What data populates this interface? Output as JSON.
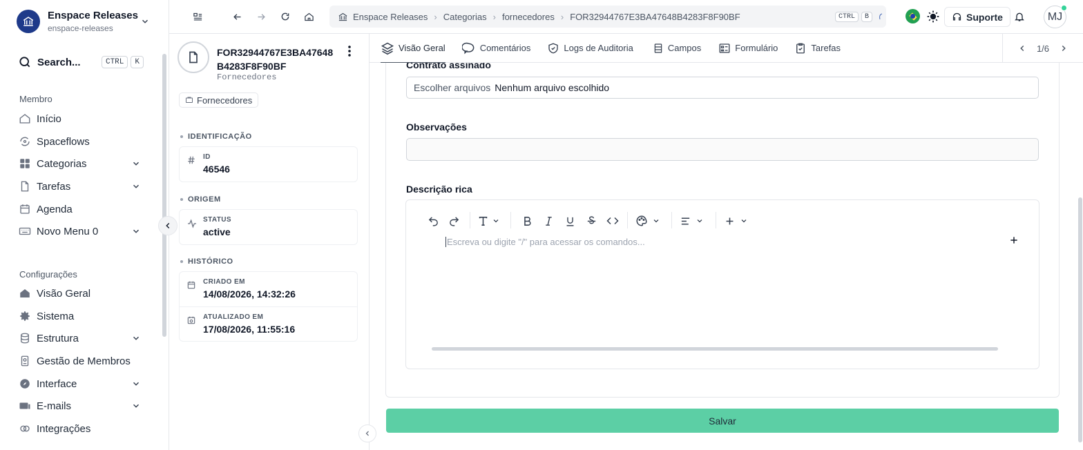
{
  "workspace": {
    "name": "Enspace Releases",
    "slug": "enspace-releases"
  },
  "search": {
    "label": "Search...",
    "shortcut": [
      "CTRL",
      "K"
    ]
  },
  "sidebar": {
    "member_section": "Membro",
    "member_items": [
      {
        "label": "Início",
        "icon": "home-icon",
        "expandable": false
      },
      {
        "label": "Spaceflows",
        "icon": "spaceflows-icon",
        "expandable": false
      },
      {
        "label": "Categorias",
        "icon": "grid-icon",
        "expandable": true
      },
      {
        "label": "Tarefas",
        "icon": "file-icon",
        "expandable": true
      },
      {
        "label": "Agenda",
        "icon": "calendar-icon",
        "expandable": false
      },
      {
        "label": "Novo Menu 0",
        "icon": "keyboard-icon",
        "expandable": true
      }
    ],
    "settings_section": "Configurações",
    "settings_items": [
      {
        "label": "Visão Geral",
        "icon": "house-filled-icon",
        "expandable": false
      },
      {
        "label": "Sistema",
        "icon": "gear-icon",
        "expandable": false
      },
      {
        "label": "Estrutura",
        "icon": "database-icon",
        "expandable": true
      },
      {
        "label": "Gestão de Membros",
        "icon": "id-badge-icon",
        "expandable": false
      },
      {
        "label": "Interface",
        "icon": "compass-icon",
        "expandable": true
      },
      {
        "label": "E-mails",
        "icon": "mail-icon",
        "expandable": true
      },
      {
        "label": "Integrações",
        "icon": "link-icon",
        "expandable": false
      }
    ]
  },
  "breadcrumb": {
    "items": [
      "Enspace Releases",
      "Categorias",
      "fornecedores",
      "FOR32944767E3BA47648B4283F8F90BF"
    ],
    "shortcut": [
      "CTRL",
      "B"
    ]
  },
  "topbar": {
    "support_label": "Suporte",
    "avatar_initials": "MJ"
  },
  "record": {
    "title": "FOR32944767E3BA47648B4283F8F90BF",
    "subtitle": "Fornecedores",
    "tag": "Fornecedores",
    "groups": [
      {
        "label": "IDENTIFICAÇÃO",
        "fields": [
          {
            "key": "ID",
            "value": "46546",
            "icon": "hash-icon"
          }
        ]
      },
      {
        "label": "ORIGEM",
        "fields": [
          {
            "key": "STATUS",
            "value": "active",
            "icon": "activity-icon"
          }
        ]
      },
      {
        "label": "HISTÓRICO",
        "fields": [
          {
            "key": "CRIADO EM",
            "value": "14/08/2026, 14:32:26",
            "icon": "calendar-icon"
          },
          {
            "key": "ATUALIZADO EM",
            "value": "17/08/2026, 11:55:16",
            "icon": "calendar-clock-icon"
          }
        ]
      }
    ]
  },
  "tabs": [
    {
      "label": "Visão Geral",
      "icon": "layers-icon",
      "active": true
    },
    {
      "label": "Comentários",
      "icon": "comment-icon",
      "active": false
    },
    {
      "label": "Logs de Auditoria",
      "icon": "shield-icon",
      "active": false
    },
    {
      "label": "Campos",
      "icon": "table-icon",
      "active": false
    },
    {
      "label": "Formulário",
      "icon": "form-icon",
      "active": false
    },
    {
      "label": "Tarefas",
      "icon": "clipboard-check-icon",
      "active": false
    }
  ],
  "pager": {
    "label": "1/6"
  },
  "form": {
    "contract": {
      "label": "Contrato assinado",
      "button": "Escolher arquivos",
      "status": "Nenhum arquivo escolhido"
    },
    "notes": {
      "label": "Observações",
      "value": ""
    },
    "rich": {
      "label": "Descrição rica",
      "placeholder": "Escreva ou digite \"/\" para acessar os comandos..."
    },
    "save_label": "Salvar"
  },
  "colors": {
    "accent": "#5ccfa5",
    "workspace_logo": "#1e3a8a",
    "online": "#34d399"
  }
}
